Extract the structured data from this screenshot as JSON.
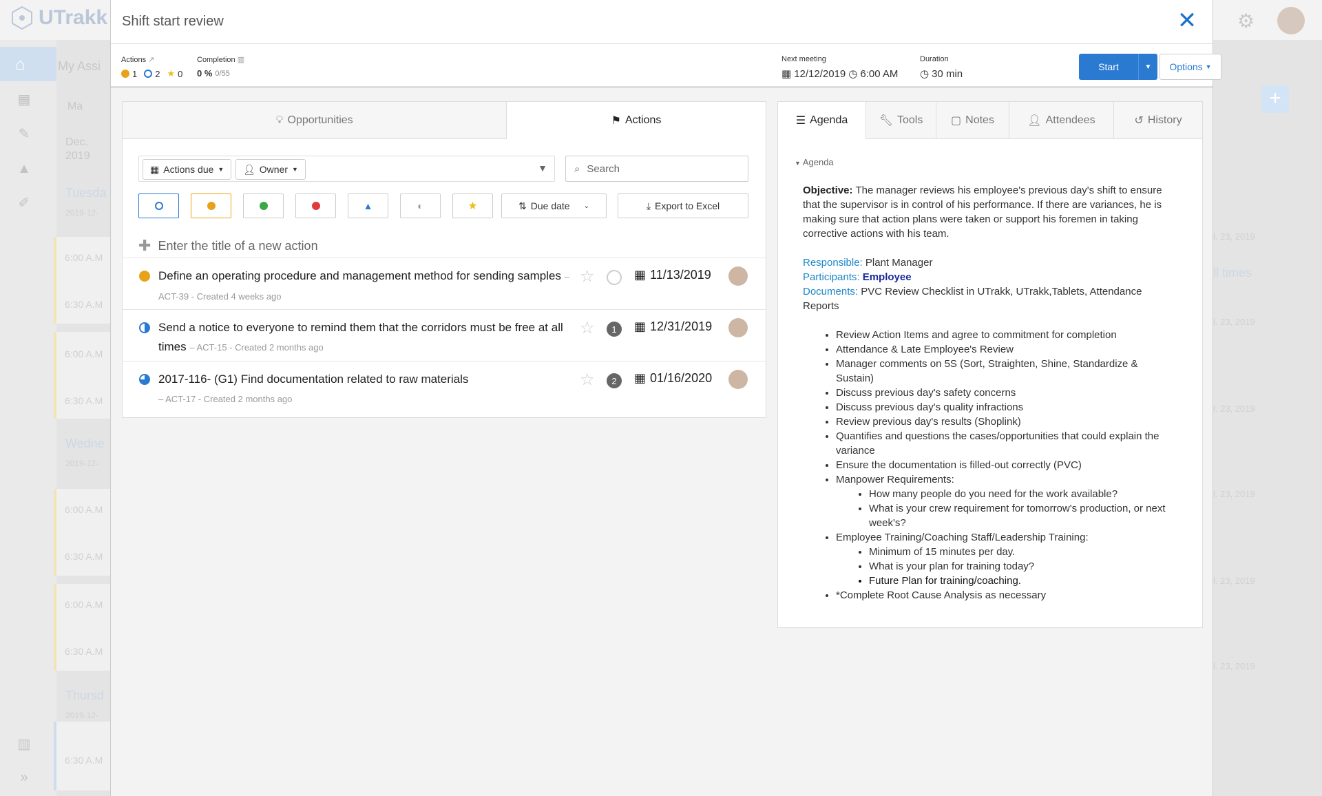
{
  "background": {
    "logo_text": "UTrakk",
    "page_title": "My Assi",
    "month_label": "Ma",
    "date_month": "Dec.",
    "date_year": "2019",
    "days": [
      "Tuesda",
      "2019-12-",
      "Wedne",
      "2019-12-",
      "Thursd",
      "2019-12-"
    ],
    "times": [
      "6:00 A.M",
      "6:30 A.M",
      "6:00 A.M",
      "6:30 A.M",
      "6:00 A.M",
      "6:30 A.M",
      "6:00 A.M",
      "6:30 A.M",
      "6:30 A.M"
    ],
    "right_dates": [
      "l. 23, 2019",
      "ll times",
      "l. 23, 2019",
      "l. 23, 2019",
      "l. 23, 2019",
      "l. 23, 2019",
      "l. 23, 2019"
    ]
  },
  "modal": {
    "title": "Shift start review",
    "close_icon": "close-icon",
    "stats": {
      "actions_label": "Actions",
      "warn_count": "1",
      "open_count": "2",
      "star_count": "0",
      "completion_label": "Completion",
      "completion_value": "0 %",
      "completion_sub": "0/55",
      "next_meeting_label": "Next meeting",
      "next_meeting_date": "12/12/2019",
      "next_meeting_time": "6:00 AM",
      "duration_label": "Duration",
      "duration_value": "30 min"
    },
    "start_label": "Start",
    "options_label": "Options"
  },
  "left_panel": {
    "tabs": [
      {
        "label": "Opportunities",
        "icon": "lightbulb-icon"
      },
      {
        "label": "Actions",
        "icon": "flag-icon"
      }
    ],
    "filters": {
      "actions_due_label": "Actions due",
      "owner_label": "Owner",
      "search_placeholder": "Search",
      "sort_label": "Due date",
      "export_label": "Export to Excel"
    },
    "new_action_placeholder": "Enter the title of a new action",
    "actions": [
      {
        "title": "Define an operating procedure and management method for sending samples",
        "meta": "– ACT-39 - Created 4 weeks ago",
        "date": "11/13/2019",
        "badge": ""
      },
      {
        "title": "Send a notice to everyone to remind them that the corridors must be free at all times",
        "meta": "– ACT-15 - Created 2 months ago",
        "date": "12/31/2019",
        "badge": "1"
      },
      {
        "title": "2017-116- (G1) Find documentation related to raw materials",
        "meta": "– ACT-17 - Created 2 months ago",
        "date": "01/16/2020",
        "badge": "2"
      }
    ]
  },
  "right_panel": {
    "tabs": [
      {
        "label": "Agenda",
        "icon": "list-icon"
      },
      {
        "label": "Tools",
        "icon": "wrench-icon"
      },
      {
        "label": "Notes",
        "icon": "note-icon"
      },
      {
        "label": "Attendees",
        "icon": "person-icon"
      },
      {
        "label": "History",
        "icon": "history-icon"
      }
    ],
    "section_label": "Agenda",
    "objective_label": "Objective:",
    "objective_text": "The manager reviews his employee's previous day's shift to ensure that the supervisor is in control of his performance. If there are variances, he is making sure that action plans were taken or support his foremen in taking corrective actions with his team.",
    "responsible_label": "Responsible:",
    "responsible_value": "Plant Manager",
    "participants_label": "Participants:",
    "participants_value": "Employee",
    "documents_label": "Documents:",
    "documents_value": "PVC Review Checklist in UTrakk, UTrakk,Tablets, Attendance Reports",
    "items": [
      "Review Action Items and agree to commitment for completion",
      "Attendance & Late Employee's Review",
      "Manager comments on 5S (Sort, Straighten, Shine, Standardize & Sustain)",
      "Discuss previous day's safety concerns",
      "Discuss previous day's quality infractions",
      "Review previous day's results (Shoplink)",
      "Quantifies and questions the cases/opportunities that could explain the variance",
      "Ensure the documentation is filled-out correctly (PVC)",
      "Manpower Requirements:",
      "Employee Training/Coaching Staff/Leadership Training:",
      "*Complete Root Cause Analysis as necessary"
    ],
    "manpower_sub": [
      "How many people do you need for the work available?",
      "What is your crew requirement for tomorrow's production, or next week's?"
    ],
    "training_sub": [
      "Minimum of 15 minutes per day.",
      "What is your plan for training today?",
      "Future Plan for training/coaching."
    ]
  },
  "colors": {
    "accent": "#2a7ad2",
    "warn": "#e8a21a",
    "success": "#3aa845",
    "danger": "#e03c3c",
    "link": "#1a86c9"
  }
}
